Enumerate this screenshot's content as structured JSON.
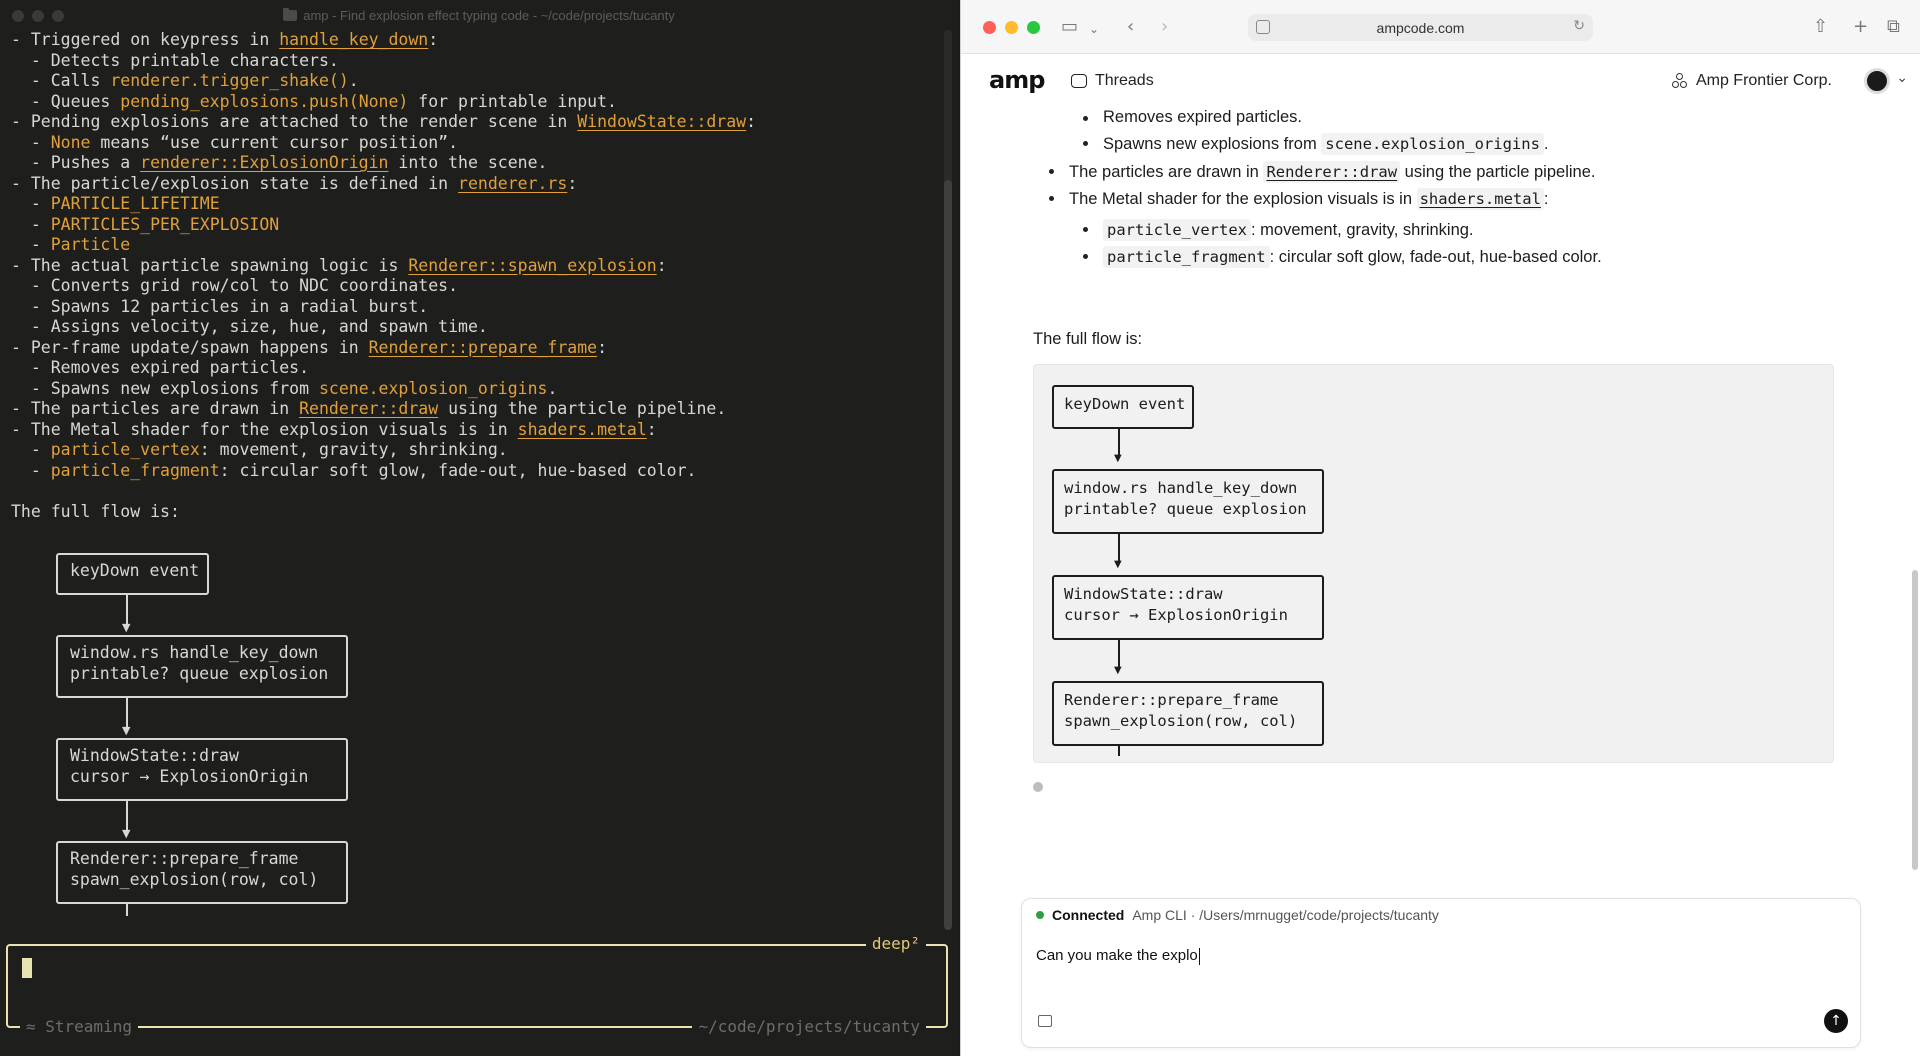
{
  "terminal": {
    "title": "amp - Find explosion effect typing code - ~/code/projects/tucanty",
    "lines": [
      [
        {
          "t": "- Triggered on keypress in "
        },
        {
          "t": "handle_key_down",
          "c": "link"
        },
        {
          "t": ":"
        }
      ],
      [
        {
          "t": "  - Detects printable characters."
        }
      ],
      [
        {
          "t": "  - Calls "
        },
        {
          "t": "renderer.trigger_shake()",
          "c": "code"
        },
        {
          "t": "."
        }
      ],
      [
        {
          "t": "  - Queues "
        },
        {
          "t": "pending_explosions.push(None)",
          "c": "code"
        },
        {
          "t": " for printable input."
        }
      ],
      [
        {
          "t": "- Pending explosions are attached to the render scene in "
        },
        {
          "t": "WindowState::draw",
          "c": "link"
        },
        {
          "t": ":"
        }
      ],
      [
        {
          "t": "  - "
        },
        {
          "t": "None",
          "c": "code"
        },
        {
          "t": " means “use current cursor position”."
        }
      ],
      [
        {
          "t": "  - Pushes a "
        },
        {
          "t": "renderer::ExplosionOrigin",
          "c": "link"
        },
        {
          "t": " into the scene."
        }
      ],
      [
        {
          "t": "- The particle/explosion state is defined in "
        },
        {
          "t": "renderer.rs",
          "c": "link"
        },
        {
          "t": ":"
        }
      ],
      [
        {
          "t": "  - "
        },
        {
          "t": "PARTICLE_LIFETIME",
          "c": "code"
        }
      ],
      [
        {
          "t": "  - "
        },
        {
          "t": "PARTICLES_PER_EXPLOSION",
          "c": "code"
        }
      ],
      [
        {
          "t": "  - "
        },
        {
          "t": "Particle",
          "c": "code"
        }
      ],
      [
        {
          "t": "- The actual particle spawning logic is "
        },
        {
          "t": "Renderer::spawn_explosion",
          "c": "link"
        },
        {
          "t": ":"
        }
      ],
      [
        {
          "t": "  - Converts grid row/col to NDC coordinates."
        }
      ],
      [
        {
          "t": "  - Spawns 12 particles in a radial burst."
        }
      ],
      [
        {
          "t": "  - Assigns velocity, size, hue, and spawn time."
        }
      ],
      [
        {
          "t": "- Per-frame update/spawn happens in "
        },
        {
          "t": "Renderer::prepare_frame",
          "c": "link"
        },
        {
          "t": ":"
        }
      ],
      [
        {
          "t": "  - Removes expired particles."
        }
      ],
      [
        {
          "t": "  - Spawns new explosions from "
        },
        {
          "t": "scene.explosion_origins",
          "c": "code"
        },
        {
          "t": "."
        }
      ],
      [
        {
          "t": "- The particles are drawn in "
        },
        {
          "t": "Renderer::draw",
          "c": "link"
        },
        {
          "t": " using the particle pipeline."
        }
      ],
      [
        {
          "t": "- The Metal shader for the explosion visuals is in "
        },
        {
          "t": "shaders.metal",
          "c": "link"
        },
        {
          "t": ":"
        }
      ],
      [
        {
          "t": "  - "
        },
        {
          "t": "particle_vertex",
          "c": "code"
        },
        {
          "t": ": movement, gravity, shrinking."
        }
      ],
      [
        {
          "t": "  - "
        },
        {
          "t": "particle_fragment",
          "c": "code"
        },
        {
          "t": ": circular soft glow, fade-out, hue-based color."
        }
      ],
      [
        {
          "t": ""
        }
      ],
      [
        {
          "t": "The full flow is:"
        }
      ]
    ],
    "flow": [
      "keyDown event",
      "window.rs handle_key_down\nprintable? queue explosion",
      "WindowState::draw\ncursor → ExplosionOrigin",
      "Renderer::prepare_frame\nspawn_explosion(row, col)"
    ],
    "input_mode": "deep²",
    "status": "≈ Streaming",
    "cwd": "~/code/projects/tucanty"
  },
  "browser": {
    "url": "ampcode.com",
    "logo": "amp",
    "threads_label": "Threads",
    "org_name": "Amp Frontier Corp.",
    "content": {
      "sub_items_top": [
        [
          {
            "t": "Removes expired particles."
          }
        ],
        [
          {
            "t": "Spawns new explosions from "
          },
          {
            "t": "scene.explosion_origins",
            "c": "code"
          },
          {
            "t": "."
          }
        ]
      ],
      "items": [
        [
          {
            "t": "The particles are drawn in "
          },
          {
            "t": "Renderer::draw",
            "c": "link"
          },
          {
            "t": " using the particle pipeline."
          }
        ],
        [
          {
            "t": "The Metal shader for the explosion visuals is in "
          },
          {
            "t": "shaders.metal",
            "c": "link"
          },
          {
            "t": ":"
          }
        ]
      ],
      "sub_items_bottom": [
        [
          {
            "t": "particle_vertex",
            "c": "code"
          },
          {
            "t": ": movement, gravity, shrinking."
          }
        ],
        [
          {
            "t": "particle_fragment",
            "c": "code"
          },
          {
            "t": ": circular soft glow, fade-out, hue-based color."
          }
        ]
      ],
      "flow_heading": "The full flow is:",
      "flow": [
        "keyDown event",
        "window.rs handle_key_down\nprintable? queue explosion",
        "WindowState::draw\ncursor → ExplosionOrigin",
        "Renderer::prepare_frame\nspawn_explosion(row, col)"
      ]
    },
    "composer": {
      "status": "Connected",
      "context": "Amp CLI · /Users/mrnugget/code/projects/tucanty",
      "input_value": "Can you make the explo"
    }
  }
}
